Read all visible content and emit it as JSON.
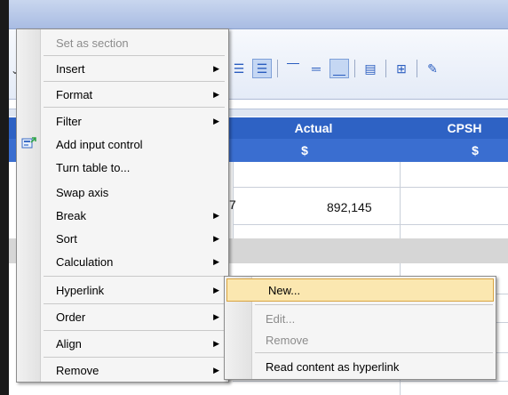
{
  "report": {
    "headers": [
      "Actual",
      "CPSH"
    ],
    "subheaders": [
      "$",
      "$"
    ],
    "partial_value": "7",
    "actual_value": "892,145"
  },
  "context_menu": {
    "items": [
      {
        "label": "Set as section",
        "disabled": true,
        "submenu": false
      },
      {
        "label": "Insert",
        "disabled": false,
        "submenu": true
      },
      {
        "label": "Format",
        "disabled": false,
        "submenu": true
      },
      {
        "label": "Filter",
        "disabled": false,
        "submenu": true
      },
      {
        "label": "Add input control",
        "disabled": false,
        "submenu": false,
        "icon": "input-control-icon"
      },
      {
        "label": "Turn table to...",
        "disabled": false,
        "submenu": false
      },
      {
        "label": "Swap axis",
        "disabled": false,
        "submenu": false
      },
      {
        "label": "Break",
        "disabled": false,
        "submenu": true
      },
      {
        "label": "Sort",
        "disabled": false,
        "submenu": true
      },
      {
        "label": "Calculation",
        "disabled": false,
        "submenu": true
      },
      {
        "label": "Hyperlink",
        "disabled": false,
        "submenu": true
      },
      {
        "label": "Order",
        "disabled": false,
        "submenu": true
      },
      {
        "label": "Align",
        "disabled": false,
        "submenu": true
      },
      {
        "label": "Remove",
        "disabled": false,
        "submenu": true
      }
    ]
  },
  "hyperlink_submenu": {
    "items": [
      {
        "label": "New...",
        "disabled": false,
        "highlighted": true
      },
      {
        "label": "Edit...",
        "disabled": true
      },
      {
        "label": "Remove",
        "disabled": true
      },
      {
        "label": "Read content as hyperlink",
        "disabled": false
      }
    ]
  },
  "colors": {
    "header_blue": "#2e62c4",
    "highlight": "#fbe7b0",
    "highlight_border": "#d9a441"
  }
}
